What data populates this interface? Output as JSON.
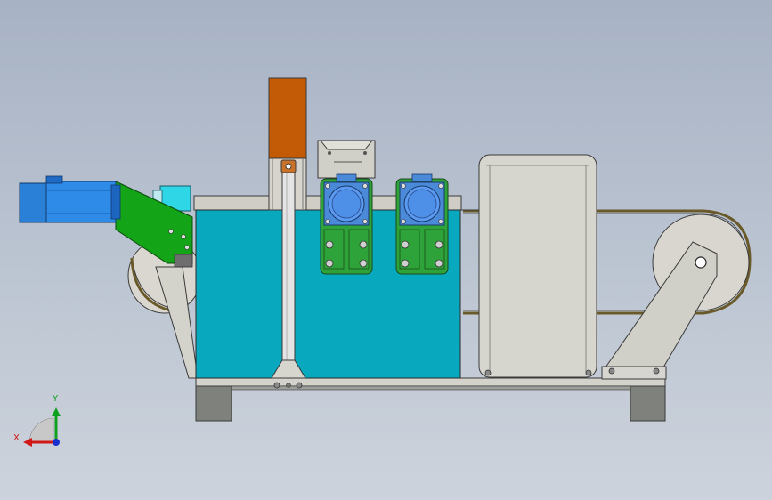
{
  "window": {
    "title": "",
    "view": "front"
  },
  "triad": {
    "x_label": "X",
    "y_label": "Y",
    "x_color": "#d01818",
    "y_color": "#10a020",
    "z_color": "#1830d0"
  },
  "colors": {
    "background_top": "#a7b2c4",
    "background_bottom": "#cdd3dc",
    "motor_blue": "#2a86e6",
    "bracket_green": "#13a418",
    "tank_cyan": "#07a8bf",
    "frame_gray": "#cfcdc6",
    "base_dark_gray": "#7e807c",
    "hopper_orange": "#c25a06",
    "bearing_green": "#2ea33a",
    "bearing_blue": "#4c8ff0"
  },
  "model": {
    "components": [
      "drive-motor",
      "motor-bracket",
      "coupling-housing",
      "belt-pulley-left",
      "coolant-tank",
      "feed-hopper",
      "vertical-post",
      "roller-bearing-unit",
      "roller-bearing-unit",
      "gear-box-housing",
      "belt-pulley-right",
      "tensioner-arm",
      "base-frame"
    ]
  }
}
